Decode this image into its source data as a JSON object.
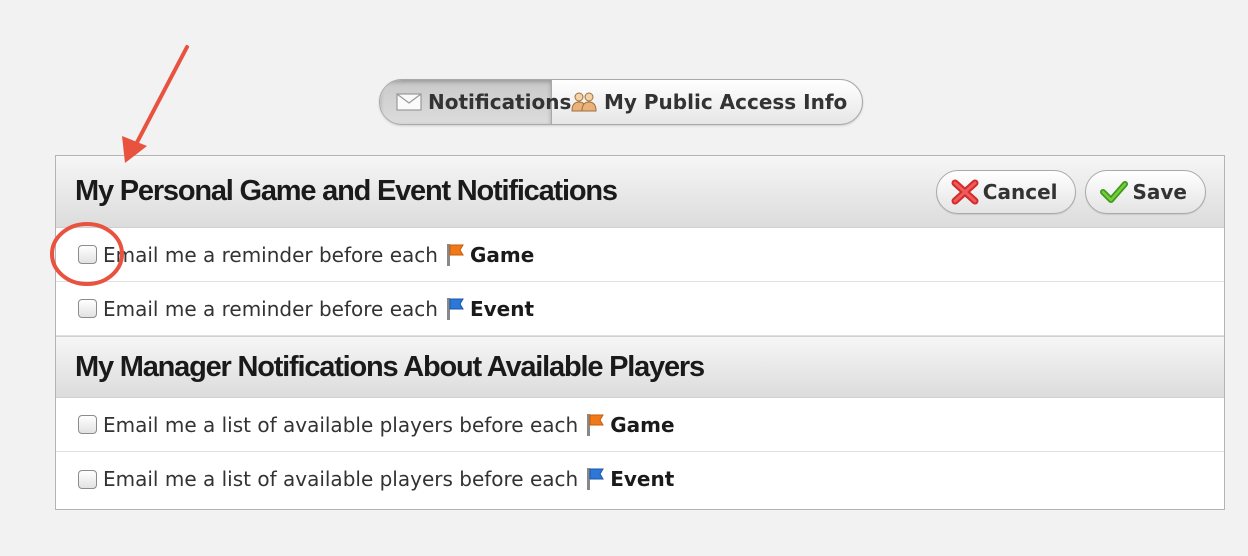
{
  "tabs": [
    {
      "label": "Notifications",
      "icon": "envelope-icon",
      "active": true
    },
    {
      "label": "My Public Access Info",
      "icon": "people-icon",
      "active": false
    }
  ],
  "section1": {
    "title": "My Personal Game and Event Notifications",
    "cancel_label": "Cancel",
    "save_label": "Save",
    "rows": [
      {
        "text": "Email me a reminder before each",
        "kind": "Game",
        "flag_color": "#f07a1a",
        "checked": false
      },
      {
        "text": "Email me a reminder before each",
        "kind": "Event",
        "flag_color": "#2b78d8",
        "checked": false
      }
    ]
  },
  "section2": {
    "title": "My Manager Notifications About Available Players",
    "rows": [
      {
        "text": "Email me a list of available players before each",
        "kind": "Game",
        "flag_color": "#f07a1a",
        "checked": false
      },
      {
        "text": "Email me a list of available players before each",
        "kind": "Event",
        "flag_color": "#2b78d8",
        "checked": false
      }
    ]
  },
  "colors": {
    "annotation": "#e8523f",
    "background": "#f2f2f2"
  }
}
